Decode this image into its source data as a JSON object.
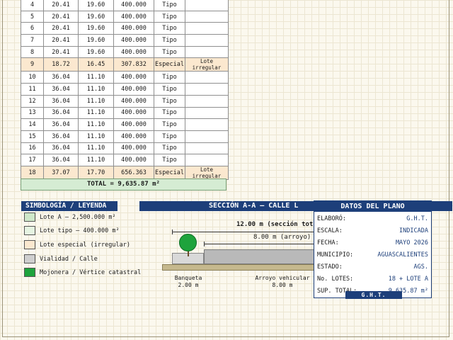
{
  "lots": [
    {
      "n": "4",
      "a": "20.41",
      "b": "19.60",
      "area": "400.000",
      "tipo": "Tipo",
      "obs": ""
    },
    {
      "n": "5",
      "a": "20.41",
      "b": "19.60",
      "area": "400.000",
      "tipo": "Tipo",
      "obs": ""
    },
    {
      "n": "6",
      "a": "20.41",
      "b": "19.60",
      "area": "400.000",
      "tipo": "Tipo",
      "obs": ""
    },
    {
      "n": "7",
      "a": "20.41",
      "b": "19.60",
      "area": "400.000",
      "tipo": "Tipo",
      "obs": ""
    },
    {
      "n": "8",
      "a": "20.41",
      "b": "19.60",
      "area": "400.000",
      "tipo": "Tipo",
      "obs": ""
    },
    {
      "n": "9",
      "a": "18.72",
      "b": "16.45",
      "area": "307.832",
      "tipo": "Especial",
      "obs": "Lote irregular",
      "special": true
    },
    {
      "n": "10",
      "a": "36.04",
      "b": "11.10",
      "area": "400.000",
      "tipo": "Tipo",
      "obs": ""
    },
    {
      "n": "11",
      "a": "36.04",
      "b": "11.10",
      "area": "400.000",
      "tipo": "Tipo",
      "obs": ""
    },
    {
      "n": "12",
      "a": "36.04",
      "b": "11.10",
      "area": "400.000",
      "tipo": "Tipo",
      "obs": ""
    },
    {
      "n": "13",
      "a": "36.04",
      "b": "11.10",
      "area": "400.000",
      "tipo": "Tipo",
      "obs": ""
    },
    {
      "n": "14",
      "a": "36.04",
      "b": "11.10",
      "area": "400.000",
      "tipo": "Tipo",
      "obs": ""
    },
    {
      "n": "15",
      "a": "36.04",
      "b": "11.10",
      "area": "400.000",
      "tipo": "Tipo",
      "obs": ""
    },
    {
      "n": "16",
      "a": "36.04",
      "b": "11.10",
      "area": "400.000",
      "tipo": "Tipo",
      "obs": ""
    },
    {
      "n": "17",
      "a": "36.04",
      "b": "11.10",
      "area": "400.000",
      "tipo": "Tipo",
      "obs": ""
    },
    {
      "n": "18",
      "a": "37.07",
      "b": "17.70",
      "area": "656.363",
      "tipo": "Especial",
      "obs": "Lote irregular",
      "special": true
    }
  ],
  "total": "TOTAL  =  9,635.87 m²",
  "legend": {
    "title": "SIMBOLOGÍA / LEYENDA",
    "items": [
      {
        "label": "Lote A  —  2,500.000 m²",
        "color": "#cfe8c9"
      },
      {
        "label": "Lote tipo  —  400.000 m²",
        "color": "#e6f4e2"
      },
      {
        "label": "Lote especial  (irregular)",
        "color": "#fbe8cf"
      },
      {
        "label": "Vialidad / Calle",
        "color": "#cfcfcf"
      },
      {
        "label": "Mojonera / Vértice catastral",
        "color": "#1ea33c"
      }
    ]
  },
  "section": {
    "title": "SECCIÓN  A-A  —  CALLE L",
    "total_dim": "12.00 m  (sección tot",
    "arroyo_dim": "8.00 m  (arroyo)",
    "banqueta_label": "Banqueta",
    "banqueta_dim": "2.00 m",
    "arroyo_label": "Arroyo vehicular",
    "arroyo_val": "8.00 m"
  },
  "datos": {
    "title": "DATOS DEL PLANO",
    "rows": [
      {
        "k": "ELABORÓ:",
        "v": "G.H.T."
      },
      {
        "k": "ESCALA:",
        "v": "INDICADA"
      },
      {
        "k": "FECHA:",
        "v": "MAYO 2026"
      },
      {
        "k": "MUNICIPIO:",
        "v": "AGUASCALIENTES"
      },
      {
        "k": "ESTADO:",
        "v": "AGS."
      },
      {
        "k": "No. LOTES:",
        "v": "18 + LOTE A"
      },
      {
        "k": "SUP. TOTAL:",
        "v": "9,635.87 m²"
      }
    ],
    "footer": "G.H.T."
  }
}
